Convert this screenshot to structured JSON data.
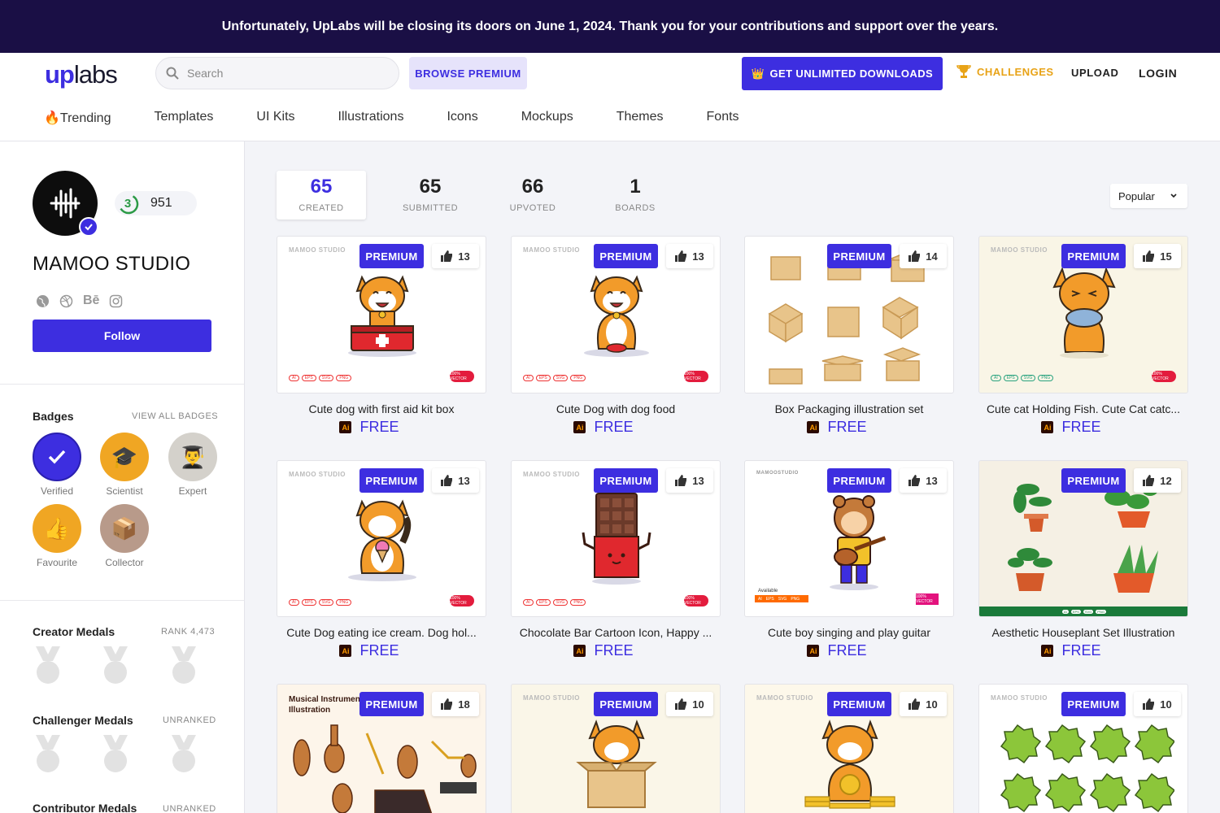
{
  "banner": {
    "text": "Unfortunately, UpLabs will be closing its doors on June 1, 2024. Thank you for your contributions and support over the years."
  },
  "header": {
    "logo_up": "up",
    "logo_labs": "labs",
    "search_placeholder": "Search",
    "browse_premium": "BROWSE PREMIUM",
    "get_unlimited": "GET UNLIMITED DOWNLOADS",
    "challenges": "CHALLENGES",
    "upload": "UPLOAD",
    "login": "LOGIN"
  },
  "nav": [
    "🔥Trending",
    "Templates",
    "UI Kits",
    "Illustrations",
    "Icons",
    "Mockups",
    "Themes",
    "Fonts"
  ],
  "profile": {
    "level": "3",
    "points": "951",
    "name": "MAMOO STUDIO",
    "follow": "Follow"
  },
  "badges": {
    "title": "Badges",
    "view_all": "VIEW ALL BADGES",
    "items": [
      {
        "label": "Verified",
        "color": "#3d2ee0"
      },
      {
        "label": "Scientist",
        "color": "#f0a623"
      },
      {
        "label": "Expert",
        "color": "#c9c6bf"
      },
      {
        "label": "Favourite",
        "color": "#f0a623"
      },
      {
        "label": "Collector",
        "color": "#b89a8a"
      }
    ]
  },
  "medals": {
    "creator": {
      "title": "Creator Medals",
      "right": "RANK 4,473"
    },
    "challenger": {
      "title": "Challenger Medals",
      "right": "UNRANKED"
    },
    "contributor": {
      "title": "Contributor Medals",
      "right": "UNRANKED"
    }
  },
  "stats": [
    {
      "num": "65",
      "cap": "CREATED"
    },
    {
      "num": "65",
      "cap": "SUBMITTED"
    },
    {
      "num": "66",
      "cap": "UPVOTED"
    },
    {
      "num": "1",
      "cap": "BOARDS"
    }
  ],
  "sort": {
    "value": "Popular"
  },
  "cards": [
    {
      "title": "Cute dog with first aid kit box",
      "likes": "13",
      "premium": "PREMIUM",
      "price": "FREE"
    },
    {
      "title": "Cute Dog with dog food",
      "likes": "13",
      "premium": "PREMIUM",
      "price": "FREE"
    },
    {
      "title": "Box Packaging illustration set",
      "likes": "14",
      "premium": "PREMIUM",
      "price": "FREE"
    },
    {
      "title": "Cute cat Holding Fish. Cute Cat catc...",
      "likes": "15",
      "premium": "PREMIUM",
      "price": "FREE"
    },
    {
      "title": "Cute Dog eating ice cream. Dog hol...",
      "likes": "13",
      "premium": "PREMIUM",
      "price": "FREE"
    },
    {
      "title": "Chocolate Bar Cartoon Icon, Happy ...",
      "likes": "13",
      "premium": "PREMIUM",
      "price": "FREE"
    },
    {
      "title": "Cute boy singing and play guitar",
      "likes": "13",
      "premium": "PREMIUM",
      "price": "FREE"
    },
    {
      "title": "Aesthetic Houseplant Set Illustration",
      "likes": "12",
      "premium": "PREMIUM",
      "price": "FREE"
    },
    {
      "title": "",
      "likes": "18",
      "premium": "PREMIUM",
      "price": "",
      "thumb_text": "Musical Instrument Illustration"
    },
    {
      "title": "",
      "likes": "10",
      "premium": "PREMIUM",
      "price": ""
    },
    {
      "title": "",
      "likes": "10",
      "premium": "PREMIUM",
      "price": ""
    },
    {
      "title": "",
      "likes": "10",
      "premium": "PREMIUM",
      "price": ""
    }
  ],
  "thumb_marks": {
    "watermark": "MAMOO STUDIO",
    "watermark2": "MAMOOSTUDIO",
    "formats": [
      "AI",
      "EPS",
      "SVG",
      "PNG"
    ],
    "vector": "100% VECTOR",
    "available": "Available",
    "ai": "Ai"
  }
}
